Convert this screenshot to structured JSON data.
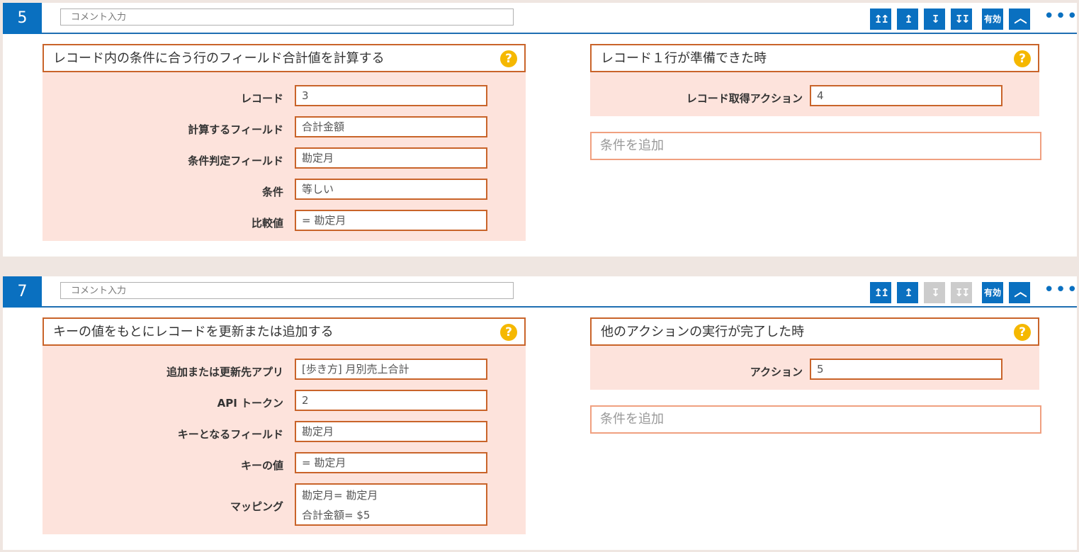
{
  "cards": [
    {
      "step": "5",
      "comment_placeholder": "コメント入力",
      "toolbar": {
        "move_top": "↥↥",
        "move_up": "↥",
        "move_down": "↧",
        "move_bottom": "↧↧",
        "enabled_label": "有効",
        "collapse": "︿",
        "more": "•••"
      },
      "action": {
        "title": "レコード内の条件に合う行のフィールド合計値を計算する",
        "help": "?",
        "fields": [
          {
            "label": "レコード",
            "value": "3"
          },
          {
            "label": "計算するフィールド",
            "value": "合計金額"
          },
          {
            "label": "条件判定フィールド",
            "value": "勘定月"
          },
          {
            "label": "条件",
            "value": "等しい"
          },
          {
            "label": "比較値",
            "value": "= 勘定月"
          }
        ]
      },
      "trigger": {
        "title": "レコード１行が準備できた時",
        "help": "?",
        "fields": [
          {
            "label": "レコード取得アクション",
            "value": "4"
          }
        ]
      },
      "add_condition": "条件を追加"
    },
    {
      "step": "7",
      "comment_placeholder": "コメント入力",
      "toolbar": {
        "move_top": "↥↥",
        "move_up": "↥",
        "move_down": "↧",
        "move_bottom": "↧↧",
        "enabled_label": "有効",
        "collapse": "︿",
        "more": "•••",
        "disabled": [
          "move_down",
          "move_bottom"
        ]
      },
      "action": {
        "title": "キーの値をもとにレコードを更新または追加する",
        "help": "?",
        "fields": [
          {
            "label": "追加または更新先アプリ",
            "value": "[歩き方] 月別売上合計"
          },
          {
            "label": "API トークン",
            "value": "2"
          },
          {
            "label": "キーとなるフィールド",
            "value": "勘定月"
          },
          {
            "label": "キーの値",
            "value": "= 勘定月"
          },
          {
            "label": "マッピング",
            "value_lines": [
              "勘定月= 勘定月",
              "合計金額= $5"
            ]
          }
        ]
      },
      "trigger": {
        "title": "他のアクションの実行が完了した時",
        "help": "?",
        "fields": [
          {
            "label": "アクション",
            "value": "5"
          }
        ]
      },
      "add_condition": "条件を追加"
    }
  ],
  "colors": {
    "accent_blue": "#0a70c0",
    "panel_bg": "#fde3dc",
    "field_border": "#c9642a",
    "help_yellow": "#f5b800",
    "disabled_gray": "#cccccc"
  }
}
